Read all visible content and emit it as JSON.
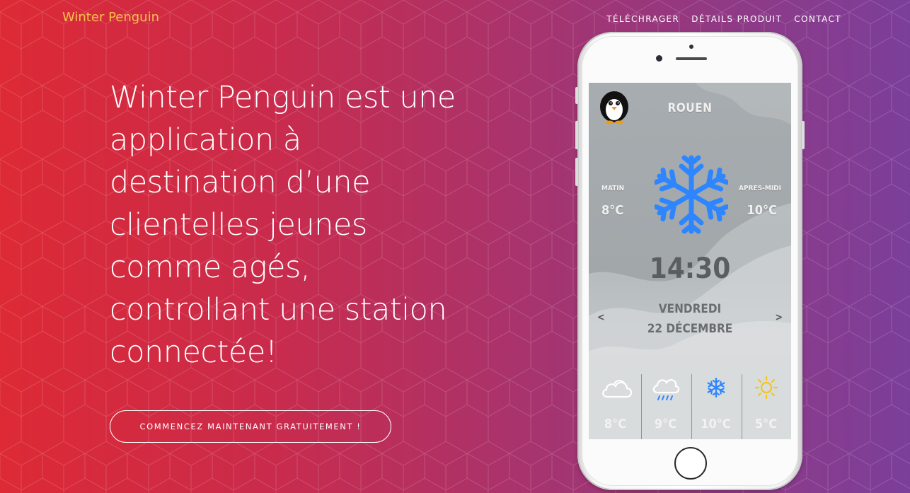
{
  "nav": {
    "brand": "Winter Penguin",
    "links": [
      "Téléchrager",
      "Détails produit",
      "Contact"
    ]
  },
  "hero": {
    "heading_lines": [
      "Winter Penguin est une",
      "application à",
      "destination d’une",
      "clientelles jeunes",
      "comme agés,",
      "controllant une station",
      "connectée!"
    ],
    "cta_label": "Commencez maintenant gratuitement !"
  },
  "phone_app": {
    "city": "ROUEN",
    "morning_label": "MATIN",
    "morning_temp": "8°C",
    "afternoon_label": "APRES-MIDI",
    "afternoon_temp": "10°C",
    "time": "14:30",
    "day": "VENDREDI",
    "date": "22 DÉCEMBRE",
    "prev_arrow": "<",
    "next_arrow": ">",
    "main_icon": "snowflake-icon",
    "forecast": [
      {
        "icon": "cloud-icon",
        "temp": "8°C"
      },
      {
        "icon": "rain-cloud-icon",
        "temp": "9°C"
      },
      {
        "icon": "snowflake-icon",
        "temp": "10°C"
      },
      {
        "icon": "sun-icon",
        "temp": "5°C"
      }
    ]
  },
  "colors": {
    "gradient_left": "#dd2a35",
    "gradient_right": "#7b3f9a",
    "brand": "#f6c04a",
    "snow_blue": "#2e86ff",
    "sun_yellow": "#f5c518"
  }
}
